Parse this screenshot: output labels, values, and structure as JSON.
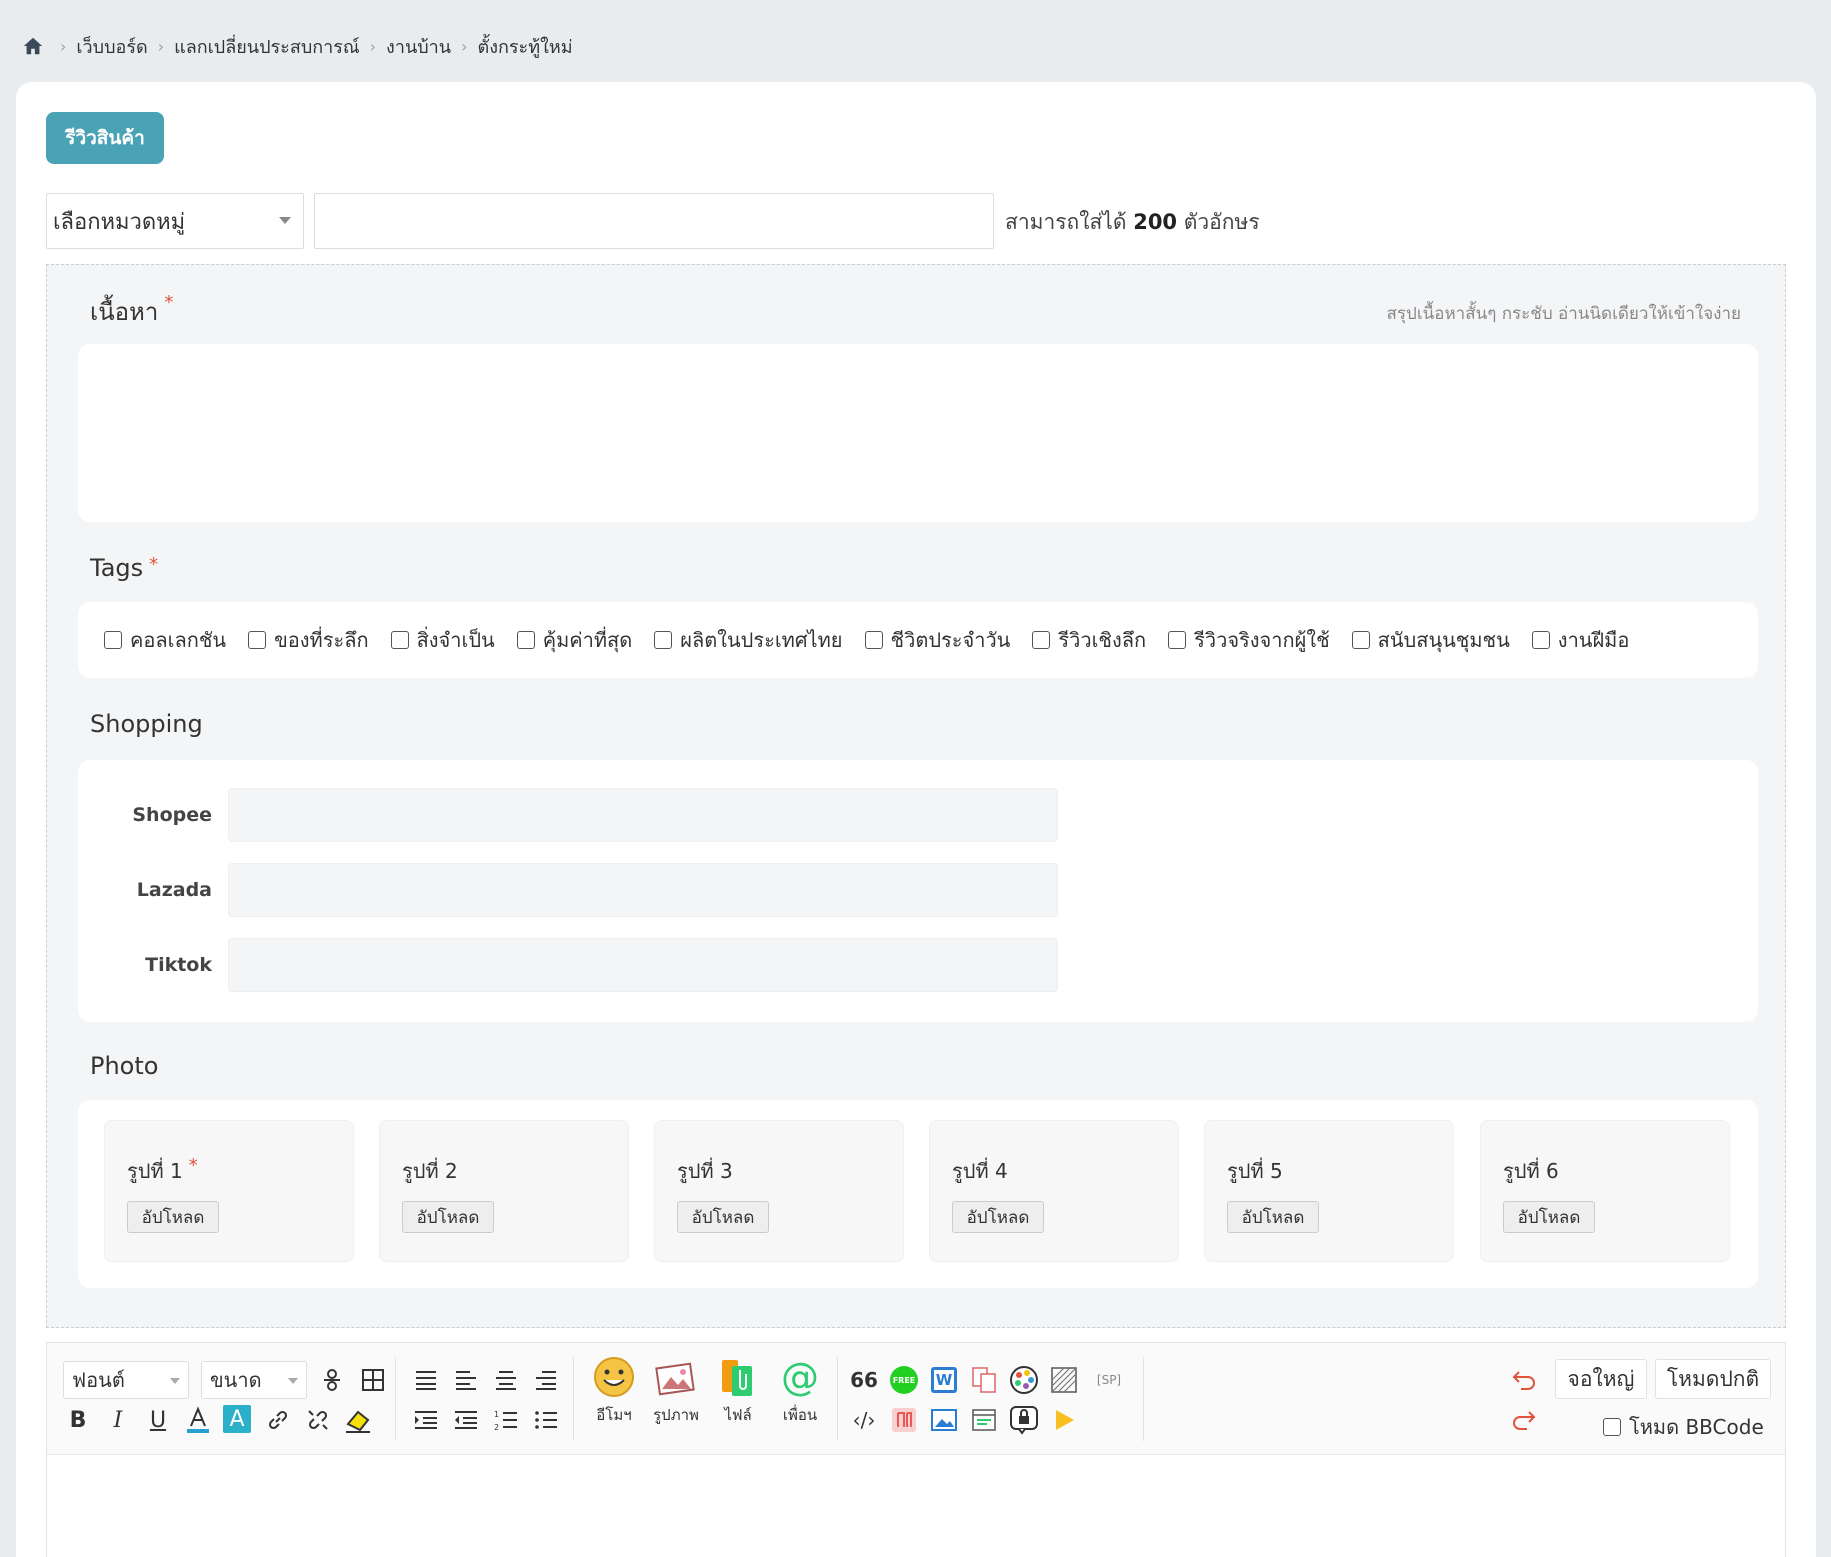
{
  "breadcrumb": {
    "items": [
      "เว็บบอร์ด",
      "แลกเปลี่ยนประสบการณ์",
      "งานบ้าน",
      "ตั้งกระทู้ใหม่"
    ]
  },
  "review_button": "รีวิวสินค้า",
  "category_select": {
    "value": "เลือกหมวดหมู่"
  },
  "title_input": {
    "value": "",
    "hint_prefix": "สามารถใส่ได้",
    "hint_count": "200",
    "hint_suffix": "ตัวอักษร"
  },
  "content": {
    "title": "เนื้อหา",
    "required_mark": "*",
    "hint": "สรุปเนื้อหาสั้นๆ กระชับ อ่านนิดเดียวให้เข้าใจง่าย"
  },
  "tags": {
    "title": "Tags",
    "required_mark": "*",
    "items": [
      "คอลเลกชัน",
      "ของที่ระลึก",
      "สิ่งจำเป็น",
      "คุ้มค่าที่สุด",
      "ผลิตในประเทศไทย",
      "ชีวิตประจำวัน",
      "รีวิวเชิงลึก",
      "รีวิวจริงจากผู้ใช้",
      "สนับสนุนชุมชน",
      "งานฝีมือ"
    ]
  },
  "shopping": {
    "title": "Shopping",
    "fields": [
      {
        "label": "Shopee",
        "value": ""
      },
      {
        "label": "Lazada",
        "value": ""
      },
      {
        "label": "Tiktok",
        "value": ""
      }
    ]
  },
  "photo": {
    "title": "Photo",
    "slots": [
      {
        "label": "รูปที่ 1",
        "required_mark": "*",
        "button": "อัปโหลด"
      },
      {
        "label": "รูปที่ 2",
        "required_mark": "",
        "button": "อัปโหลด"
      },
      {
        "label": "รูปที่ 3",
        "required_mark": "",
        "button": "อัปโหลด"
      },
      {
        "label": "รูปที่ 4",
        "required_mark": "",
        "button": "อัปโหลด"
      },
      {
        "label": "รูปที่ 5",
        "required_mark": "",
        "button": "อัปโหลด"
      },
      {
        "label": "รูปที่ 6",
        "required_mark": "",
        "button": "อัปโหลด"
      }
    ]
  },
  "editor": {
    "font_select": "ฟอนต์",
    "size_select": "ขนาด",
    "emoji_label": "อีโมฯ",
    "image_label": "รูปภาพ",
    "file_label": "ไฟล์",
    "friend_label": "เพื่อน",
    "quote_glyph": "66",
    "sp_tag": "[SP]",
    "free_badge": "FREE",
    "word_badge": "W",
    "fullscreen_button": "จอใหญ่",
    "normal_mode_button": "โหมดปกติ",
    "bbcode_label": "โหมด BBCode"
  },
  "colors": {
    "accent": "#4aa3b5",
    "required": "#e0523c",
    "page_bg": "#e9ecef"
  }
}
